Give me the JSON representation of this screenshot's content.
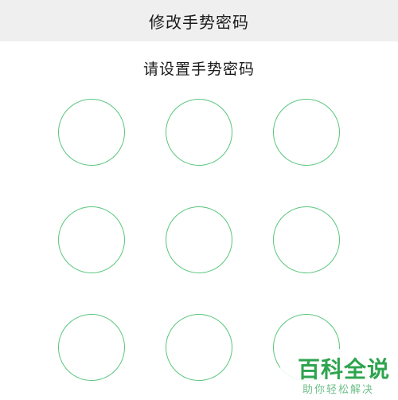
{
  "header": {
    "title": "修改手势密码"
  },
  "main": {
    "prompt": "请设置手势密码",
    "pattern_points": [
      "1",
      "2",
      "3",
      "4",
      "5",
      "6",
      "7",
      "8",
      "9"
    ]
  },
  "watermark": {
    "title": "百科全说",
    "subtitle": "助你轻松解决"
  },
  "colors": {
    "accent": "#5ac67e",
    "header_bg": "#efefef"
  }
}
